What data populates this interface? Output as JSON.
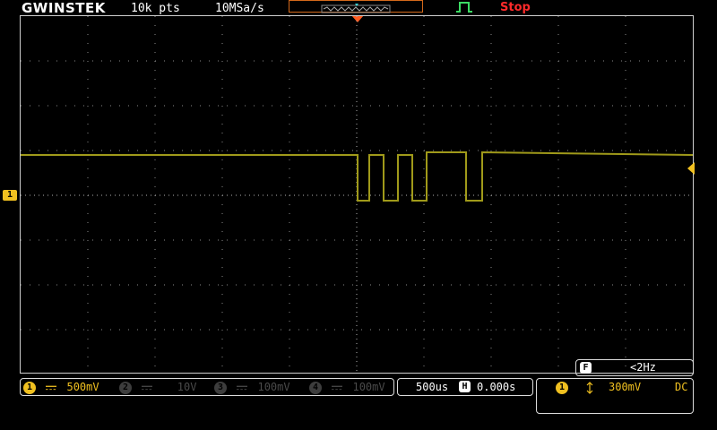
{
  "header": {
    "brand": "GWINSTEK",
    "record_length": "10k pts",
    "sample_rate": "10MSa/s",
    "status": "Stop",
    "status_color": "#ff2a2a"
  },
  "channels": [
    {
      "num": "1",
      "coupling_icon": "dc-coupling-icon",
      "scale": "500mV",
      "active": true
    },
    {
      "num": "2",
      "coupling_icon": "dc-coupling-icon",
      "scale": "10V",
      "active": false
    },
    {
      "num": "3",
      "coupling_icon": "dc-coupling-icon",
      "scale": "100mV",
      "active": false
    },
    {
      "num": "4",
      "coupling_icon": "dc-coupling-icon",
      "scale": "100mV",
      "active": false
    }
  ],
  "timebase": {
    "scale": "500us",
    "horiz_label": "H",
    "position": "0.000s"
  },
  "trigger": {
    "channel": "1",
    "slope_icon": "edge-either-icon",
    "level": "300mV",
    "coupling": "DC"
  },
  "frequency": {
    "label": "F",
    "value": "<2Hz"
  },
  "ch1_marker": "1",
  "colors": {
    "ch1": "#f0c020",
    "trace": "#a09a1a",
    "trigger_marker": "#ff5a1f",
    "grid": "#cfcfcf"
  }
}
